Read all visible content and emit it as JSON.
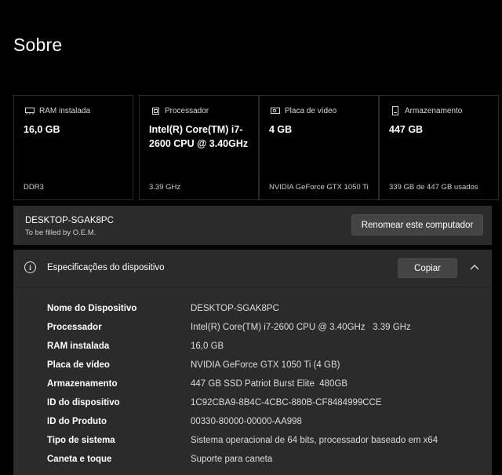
{
  "page": {
    "title": "Sobre"
  },
  "cards": [
    {
      "icon": "ram-icon",
      "header": "RAM instalada",
      "value": "16,0 GB",
      "sub": "DDR3"
    },
    {
      "icon": "processor-icon",
      "header": "Processador",
      "value": "Intel(R) Core(TM) i7-2600 CPU @ 3.40GHz",
      "sub": "3.39 GHz"
    },
    {
      "icon": "gpu-icon",
      "header": "Placa de vídeo",
      "value": "4 GB",
      "sub": "NVIDIA GeForce GTX 1050 Ti"
    },
    {
      "icon": "storage-icon",
      "header": "Armazenamento",
      "value": "447 GB",
      "sub": "339 GB de 447 GB usados"
    }
  ],
  "pc": {
    "name": "DESKTOP-SGAK8PC",
    "subtitle": "To be filled by O.E.M.",
    "rename_label": "Renomear este computador"
  },
  "specs": {
    "title": "Especificações do dispositivo",
    "copy_label": "Copiar",
    "rows": [
      {
        "key": "Nome do Dispositivo",
        "value": "DESKTOP-SGAK8PC"
      },
      {
        "key": "Processador",
        "value": "Intel(R) Core(TM) i7-2600 CPU @ 3.40GHz   3.39 GHz"
      },
      {
        "key": "RAM instalada",
        "value": "16,0 GB"
      },
      {
        "key": "Placa de vídeo",
        "value": "NVIDIA GeForce GTX 1050 Ti (4 GB)"
      },
      {
        "key": "Armazenamento",
        "value": "447 GB SSD Patriot Burst Elite  480GB"
      },
      {
        "key": "ID do dispositivo",
        "value": "1C92CBA9-8B4C-4CBC-880B-CF8484999CCE"
      },
      {
        "key": "ID do Produto",
        "value": "00330-80000-00000-AA998"
      },
      {
        "key": "Tipo de sistema",
        "value": "Sistema operacional de 64 bits, processador baseado em x64"
      },
      {
        "key": "Caneta e toque",
        "value": "Suporte para caneta"
      }
    ]
  },
  "colors": {
    "background": "#000000",
    "panel": "#2b2b2b",
    "button": "#444444"
  }
}
